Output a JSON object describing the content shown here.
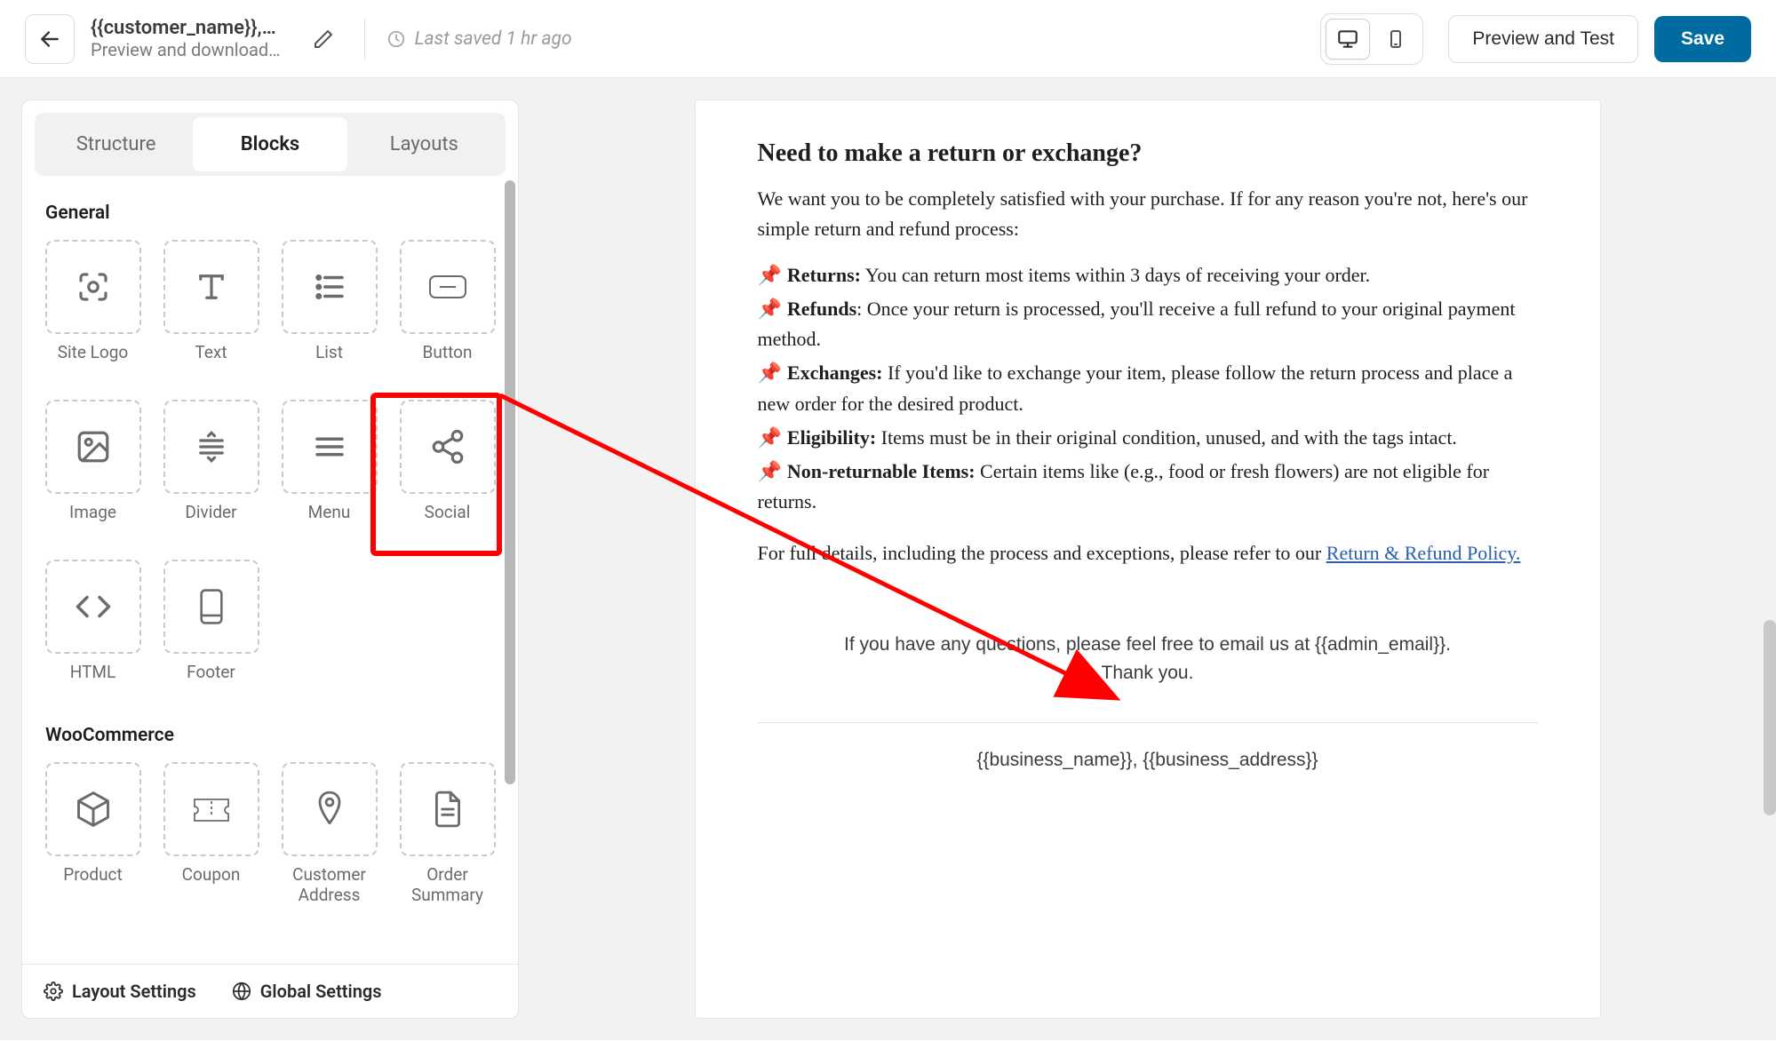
{
  "header": {
    "title": "{{customer_name}},…",
    "subtitle": "Preview and download…",
    "last_saved": "Last saved 1 hr ago",
    "preview_test": "Preview and Test",
    "save": "Save"
  },
  "sidebar": {
    "tabs": [
      "Structure",
      "Blocks",
      "Layouts"
    ],
    "section_general": "General",
    "section_woo": "WooCommerce",
    "general_blocks": [
      {
        "key": "site-logo",
        "label": "Site Logo"
      },
      {
        "key": "text",
        "label": "Text"
      },
      {
        "key": "list",
        "label": "List"
      },
      {
        "key": "button",
        "label": "Button"
      },
      {
        "key": "image",
        "label": "Image"
      },
      {
        "key": "divider",
        "label": "Divider"
      },
      {
        "key": "menu",
        "label": "Menu"
      },
      {
        "key": "social",
        "label": "Social"
      },
      {
        "key": "html",
        "label": "HTML"
      },
      {
        "key": "footer",
        "label": "Footer"
      }
    ],
    "woo_blocks": [
      {
        "key": "product",
        "label": "Product"
      },
      {
        "key": "coupon",
        "label": "Coupon"
      },
      {
        "key": "customer-address",
        "label": "Customer Address"
      },
      {
        "key": "order-summary",
        "label": "Order Summary"
      }
    ],
    "footer": {
      "layout_settings": "Layout Settings",
      "global_settings": "Global Settings"
    }
  },
  "email": {
    "heading": "Need to make a return or exchange?",
    "intro": "We want you to be completely satisfied with your purchase. If for any reason you're not, here's our simple return and refund process:",
    "items": [
      {
        "label": "Returns:",
        "text": " You can return most items within 3 days of receiving your order."
      },
      {
        "label": "Refunds",
        "text": ": Once your return is processed, you'll receive a full refund to your original payment method."
      },
      {
        "label": "Exchanges:",
        "text": " If you'd like to exchange your item, please follow the return process and place a new order for the desired product."
      },
      {
        "label": "Eligibility:",
        "text": " Items must be in their original condition, unused, and with the tags intact."
      },
      {
        "label": "Non-returnable Items:",
        "text": " Certain items like (e.g., food or fresh flowers) are not eligible for returns."
      }
    ],
    "details_prefix": "For full details, including the process and exceptions, please refer to our ",
    "details_link": "Return & Refund Policy.",
    "footer_q": "If you have any questions, please feel free to email us at {{admin_email}}.",
    "footer_thanks": "Thank you.",
    "business_line": "{{business_name}}, {{business_address}}"
  }
}
